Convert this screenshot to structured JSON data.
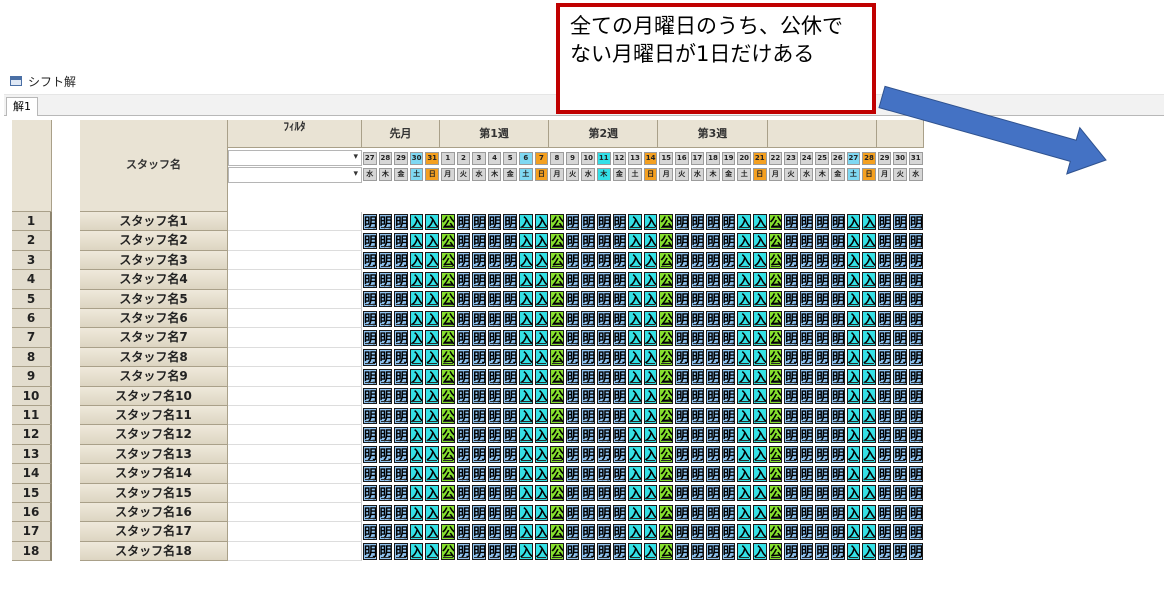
{
  "window": {
    "title": "シフト解"
  },
  "tabs": [
    {
      "label": "解1"
    }
  ],
  "header": {
    "staff_label": "スタッフ名",
    "filter_label": "ﾌｨﾙﾀ",
    "groups": [
      {
        "label": "先月",
        "start": 0,
        "span": 5
      },
      {
        "label": "第1週",
        "start": 5,
        "span": 7
      },
      {
        "label": "第2週",
        "start": 12,
        "span": 7
      },
      {
        "label": "第3週",
        "start": 19,
        "span": 7
      },
      {
        "label": "",
        "start": 26,
        "span": 7
      },
      {
        "label": "",
        "start": 33,
        "span": 3
      }
    ]
  },
  "days": [
    {
      "date": "27",
      "dow": "水",
      "type": "weekday"
    },
    {
      "date": "28",
      "dow": "木",
      "type": "weekday"
    },
    {
      "date": "29",
      "dow": "金",
      "type": "weekday"
    },
    {
      "date": "30",
      "dow": "土",
      "type": "sat"
    },
    {
      "date": "31",
      "dow": "日",
      "type": "sun"
    },
    {
      "date": "1",
      "dow": "月",
      "type": "weekday"
    },
    {
      "date": "2",
      "dow": "火",
      "type": "weekday"
    },
    {
      "date": "3",
      "dow": "水",
      "type": "weekday"
    },
    {
      "date": "4",
      "dow": "木",
      "type": "weekday"
    },
    {
      "date": "5",
      "dow": "金",
      "type": "weekday"
    },
    {
      "date": "6",
      "dow": "土",
      "type": "sat"
    },
    {
      "date": "7",
      "dow": "日",
      "type": "sun"
    },
    {
      "date": "8",
      "dow": "月",
      "type": "weekday"
    },
    {
      "date": "9",
      "dow": "火",
      "type": "weekday"
    },
    {
      "date": "10",
      "dow": "水",
      "type": "weekday"
    },
    {
      "date": "11",
      "dow": "木",
      "type": "holiday"
    },
    {
      "date": "12",
      "dow": "金",
      "type": "weekday"
    },
    {
      "date": "13",
      "dow": "土",
      "type": "weekday"
    },
    {
      "date": "14",
      "dow": "日",
      "type": "sun"
    },
    {
      "date": "15",
      "dow": "月",
      "type": "weekday"
    },
    {
      "date": "16",
      "dow": "火",
      "type": "weekday"
    },
    {
      "date": "17",
      "dow": "水",
      "type": "weekday"
    },
    {
      "date": "18",
      "dow": "木",
      "type": "weekday"
    },
    {
      "date": "19",
      "dow": "金",
      "type": "weekday"
    },
    {
      "date": "20",
      "dow": "土",
      "type": "weekday"
    },
    {
      "date": "21",
      "dow": "日",
      "type": "sun"
    },
    {
      "date": "22",
      "dow": "月",
      "type": "weekday"
    },
    {
      "date": "23",
      "dow": "火",
      "type": "weekday"
    },
    {
      "date": "24",
      "dow": "水",
      "type": "weekday"
    },
    {
      "date": "25",
      "dow": "木",
      "type": "weekday"
    },
    {
      "date": "26",
      "dow": "金",
      "type": "weekday"
    },
    {
      "date": "27",
      "dow": "土",
      "type": "sat"
    },
    {
      "date": "28",
      "dow": "日",
      "type": "sun"
    },
    {
      "date": "29",
      "dow": "月",
      "type": "weekday"
    },
    {
      "date": "30",
      "dow": "火",
      "type": "weekday"
    },
    {
      "date": "31",
      "dow": "水",
      "type": "weekday"
    }
  ],
  "day_colors": {
    "weekday": "#d6d6d6",
    "sat": "#7fd8f2",
    "sun": "#f4a020",
    "holiday": "#33e0e8"
  },
  "shift_colors": {
    "明": "#8fc3f0",
    "入": "#35e0e5",
    "公": "#86e02e"
  },
  "shift_pattern": [
    "明",
    "明",
    "明",
    "入",
    "入",
    "公",
    "明",
    "明",
    "明",
    "明",
    "入",
    "入",
    "公",
    "明",
    "明",
    "明",
    "明",
    "入",
    "入",
    "公",
    "明",
    "明",
    "明",
    "明",
    "入",
    "入",
    "公",
    "明",
    "明",
    "明",
    "明",
    "入",
    "入",
    "明",
    "明",
    "明"
  ],
  "staff": [
    {
      "no": "1",
      "name": "スタッフ名1"
    },
    {
      "no": "2",
      "name": "スタッフ名2"
    },
    {
      "no": "3",
      "name": "スタッフ名3"
    },
    {
      "no": "4",
      "name": "スタッフ名4"
    },
    {
      "no": "5",
      "name": "スタッフ名5"
    },
    {
      "no": "6",
      "name": "スタッフ名6"
    },
    {
      "no": "7",
      "name": "スタッフ名7"
    },
    {
      "no": "8",
      "name": "スタッフ名8"
    },
    {
      "no": "9",
      "name": "スタッフ名9"
    },
    {
      "no": "10",
      "name": "スタッフ名10"
    },
    {
      "no": "11",
      "name": "スタッフ名11"
    },
    {
      "no": "12",
      "name": "スタッフ名12"
    },
    {
      "no": "13",
      "name": "スタッフ名13"
    },
    {
      "no": "14",
      "name": "スタッフ名14"
    },
    {
      "no": "15",
      "name": "スタッフ名15"
    },
    {
      "no": "16",
      "name": "スタッフ名16"
    },
    {
      "no": "17",
      "name": "スタッフ名17"
    },
    {
      "no": "18",
      "name": "スタッフ名18"
    }
  ],
  "callout": {
    "text": "全ての月曜日のうち、公休でない月曜日が1日だけある"
  },
  "colors": {
    "callout_border": "#c00000",
    "arrow_fill": "#4472c4"
  }
}
